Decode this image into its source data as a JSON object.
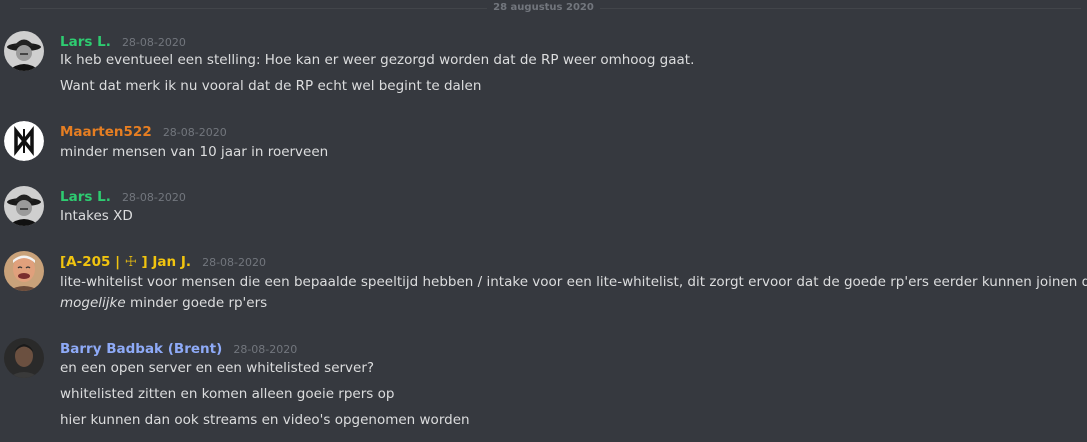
{
  "date_divider": "28 augustus 2020",
  "colors": {
    "background": "#36393f",
    "message_text": "#dcddde",
    "timestamp": "#72767d",
    "lars": "#2ecc71",
    "maarten": "#e67e22",
    "jan": "#f1c40f",
    "barry": "#8eaaf7"
  },
  "messages": [
    {
      "username": "Lars L.",
      "timestamp": "28-08-2020",
      "avatar": "man-with-hat-avatar",
      "lines": [
        "Ik heb eventueel een stelling: Hoe kan er weer gezorgd worden dat de RP weer omhoog gaat.",
        "Want dat merk ik nu vooral dat de RP echt wel begint te dalen"
      ]
    },
    {
      "username": "Maarten522",
      "timestamp": "28-08-2020",
      "avatar": "mw-logo-avatar",
      "lines": [
        "minder mensen van 10 jaar in roerveen"
      ]
    },
    {
      "username": "Lars L.",
      "timestamp": "28-08-2020",
      "avatar": "man-with-hat-avatar",
      "lines": [
        "Intakes XD"
      ]
    },
    {
      "username": "[A-205 | ☩ ] Jan J.",
      "timestamp": "28-08-2020",
      "avatar": "laughing-man-avatar",
      "lines": [
        "lite-whitelist voor mensen die een bepaalde speeltijd hebben / intake voor een lite-whitelist, dit zorgt ervoor dat de goede rp'ers eerder kunnen joinen dan"
      ],
      "line2_italic": "mogelijke",
      "line2_rest": " minder goede rp'ers"
    },
    {
      "username": "Barry Badbak (Brent)",
      "timestamp": "28-08-2020",
      "avatar": "dark-portrait-avatar",
      "lines": [
        "en een open server en een whitelisted server?",
        "whitelisted zitten en komen alleen goeie rpers op",
        "hier kunnen dan ook streams en video's opgenomen worden"
      ]
    }
  ]
}
